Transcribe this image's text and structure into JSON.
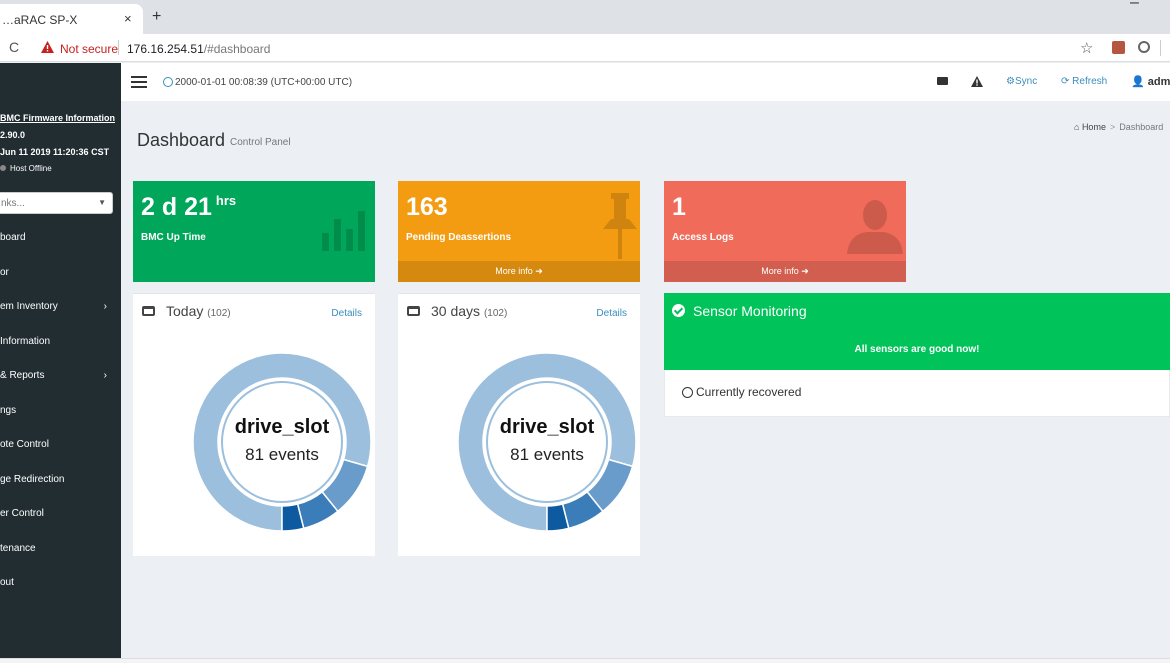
{
  "browser": {
    "tab_title": "…aRAC SP-X",
    "tab_close": "×",
    "new_tab": "+",
    "minimize": "–",
    "reload": "C",
    "security_text": "Not secure",
    "url_host": "176.16.254.51",
    "url_path": "/#dashboard",
    "star": "☆"
  },
  "sidebar": {
    "fw_title": "BMC Firmware Information",
    "fw_version": "2.90.0",
    "fw_date": "Jun 11 2019 11:20:36 CST",
    "host_status": "Host Offline",
    "quicklinks_placeholder": "nks...",
    "quicklinks_caret": "▼",
    "items": [
      {
        "label": "board",
        "chevron": ""
      },
      {
        "label": "or",
        "chevron": ""
      },
      {
        "label": "em Inventory",
        "chevron": "›"
      },
      {
        "label": "Information",
        "chevron": ""
      },
      {
        "label": "& Reports",
        "chevron": "›"
      },
      {
        "label": "ngs",
        "chevron": ""
      },
      {
        "label": "ote Control",
        "chevron": ""
      },
      {
        "label": "ge Redirection",
        "chevron": ""
      },
      {
        "label": "er Control",
        "chevron": ""
      },
      {
        "label": "tenance",
        "chevron": ""
      },
      {
        "label": "out",
        "chevron": ""
      }
    ]
  },
  "topnav": {
    "datetime": "2000-01-01 00:08:39 (UTC+00:00 UTC)",
    "sync_label": "Sync",
    "refresh_label": "Refresh",
    "user_label": "adm"
  },
  "header": {
    "title": "Dashboard",
    "subtitle": "Control Panel",
    "breadcrumb_home": "Home",
    "breadcrumb_sep": ">",
    "breadcrumb_current": "Dashboard"
  },
  "boxes": {
    "uptime": {
      "value": "2 d 21",
      "unit": "hrs",
      "label": "BMC Up Time",
      "color": "#00a65a"
    },
    "deassertions": {
      "value": "163",
      "label": "Pending Deassertions",
      "footer": "More info",
      "color": "#f39c12"
    },
    "access_logs": {
      "value": "1",
      "label": "Access Logs",
      "footer": "More info",
      "color": "#f06b5a"
    }
  },
  "panels": {
    "today": {
      "title": "Today",
      "count": "(102)",
      "details": "Details",
      "center_label": "drive_slot",
      "center_sub": "81 events",
      "segments": [
        81,
        10,
        7,
        4
      ]
    },
    "days30": {
      "title": "30 days",
      "count": "(102)",
      "details": "Details",
      "center_label": "drive_slot",
      "center_sub": "81 events",
      "segments": [
        81,
        10,
        7,
        4
      ]
    }
  },
  "donut_colors": [
    "#9bbfdd",
    "#6a9ccb",
    "#3b7db8",
    "#0d5aa0"
  ],
  "sensor": {
    "title": "Sensor Monitoring",
    "message": "All sensors are good now!",
    "recovered": "Currently recovered",
    "color": "#00c35a"
  }
}
